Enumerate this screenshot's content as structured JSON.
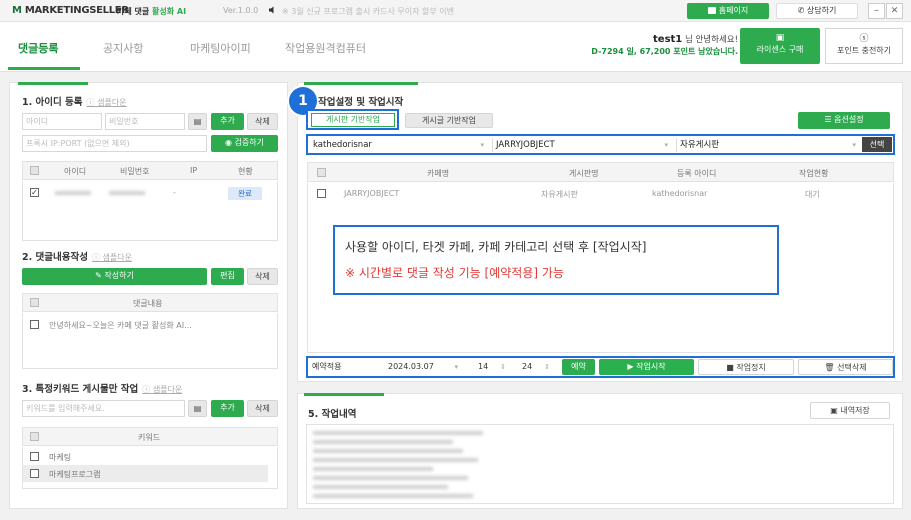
{
  "app": {
    "logo_prefix": "M",
    "logo_brand": "MARKETINGSELLER",
    "product": "카페 댓글",
    "product_ai": "활성화 AI",
    "version": "Ver.1.0.0",
    "announcement": "※ 3월 신규 프로그램 출시 카드사 무이자 할부 이벤",
    "home_button": "홈페이지",
    "consult_button": "상담하기"
  },
  "header": {
    "tabs": [
      "댓글등록",
      "공지사항",
      "마케팅아이피",
      "작업용원격컴퓨터"
    ],
    "active_tab": 0,
    "user_name": "test1",
    "greeting": "님 안녕하세요!",
    "remaining": "D-7294 일, 67,200 포인트 남았습니다.",
    "license_button": "라이센스 구매",
    "point_button": "포인트 충전하기"
  },
  "left": {
    "sec1": {
      "title": "1. 아이디 등록",
      "sample": "샘플다운",
      "id_placeholder": "아이디",
      "pw_placeholder": "비밀번호",
      "add": "추가",
      "delete": "삭제",
      "proxy_placeholder": "프록시 IP:PORT (없으면 제외)",
      "verify": "검증하기",
      "columns": [
        "아이디",
        "비밀번호",
        "IP",
        "현황"
      ],
      "row_ip": "-",
      "row_status": "완료"
    },
    "sec2": {
      "title": "2. 댓글내용작성",
      "sample": "샘플다운",
      "write": "작성하기",
      "edit": "편집",
      "delete": "삭제",
      "column": "댓글내용",
      "row": "안녕하세요~오늘은 카페 댓글 활성화 AI..."
    },
    "sec3": {
      "title": "3. 특정키워드 게시물만 작업",
      "sample": "샘플다운",
      "keyword_placeholder": "키워드를 입력해주세요.",
      "add": "추가",
      "delete": "삭제",
      "column": "키워드",
      "rows": [
        "마케팅",
        "마케팅프로그램"
      ]
    }
  },
  "right": {
    "step_badge": "1",
    "sec4_title": "작업설정 및 작업시작",
    "subtabs": [
      "게시판 기반작업",
      "게시글 기반작업"
    ],
    "option_button": "옵션설정",
    "selects": {
      "account": "kathedorisnar",
      "cafe": "JARRYJOBJECT",
      "board": "자유게시판"
    },
    "select_button": "선택",
    "columns": [
      "카페명",
      "게시판명",
      "등록 아이디",
      "작업현황"
    ],
    "rows": [
      {
        "cafe": "JARRYJOBJECT",
        "board": "자유게시판",
        "id": "kathedorisnar",
        "status": "대기"
      }
    ],
    "callout_line1": "사용할 아이디, 타겟 카페, 카페 카테고리 선택 후 [작업시작]",
    "callout_line2": "※ 시간별로 댓글 작성 기능 [예약적용] 가능",
    "schedule": {
      "label": "예약적용",
      "date": "2024.03.07",
      "hour": "14",
      "minute": "24",
      "reserve": "예약",
      "start": "작업시작",
      "stop": "작업정지",
      "delete_sel": "선택삭제"
    },
    "sec5_title": "5. 작업내역",
    "save_log": "내역저장"
  },
  "colors": {
    "accent_green": "#2eaa4f",
    "highlight_blue": "#1f6fd8",
    "callout_red": "#e53935",
    "logo_green": "#1a6f3a"
  }
}
